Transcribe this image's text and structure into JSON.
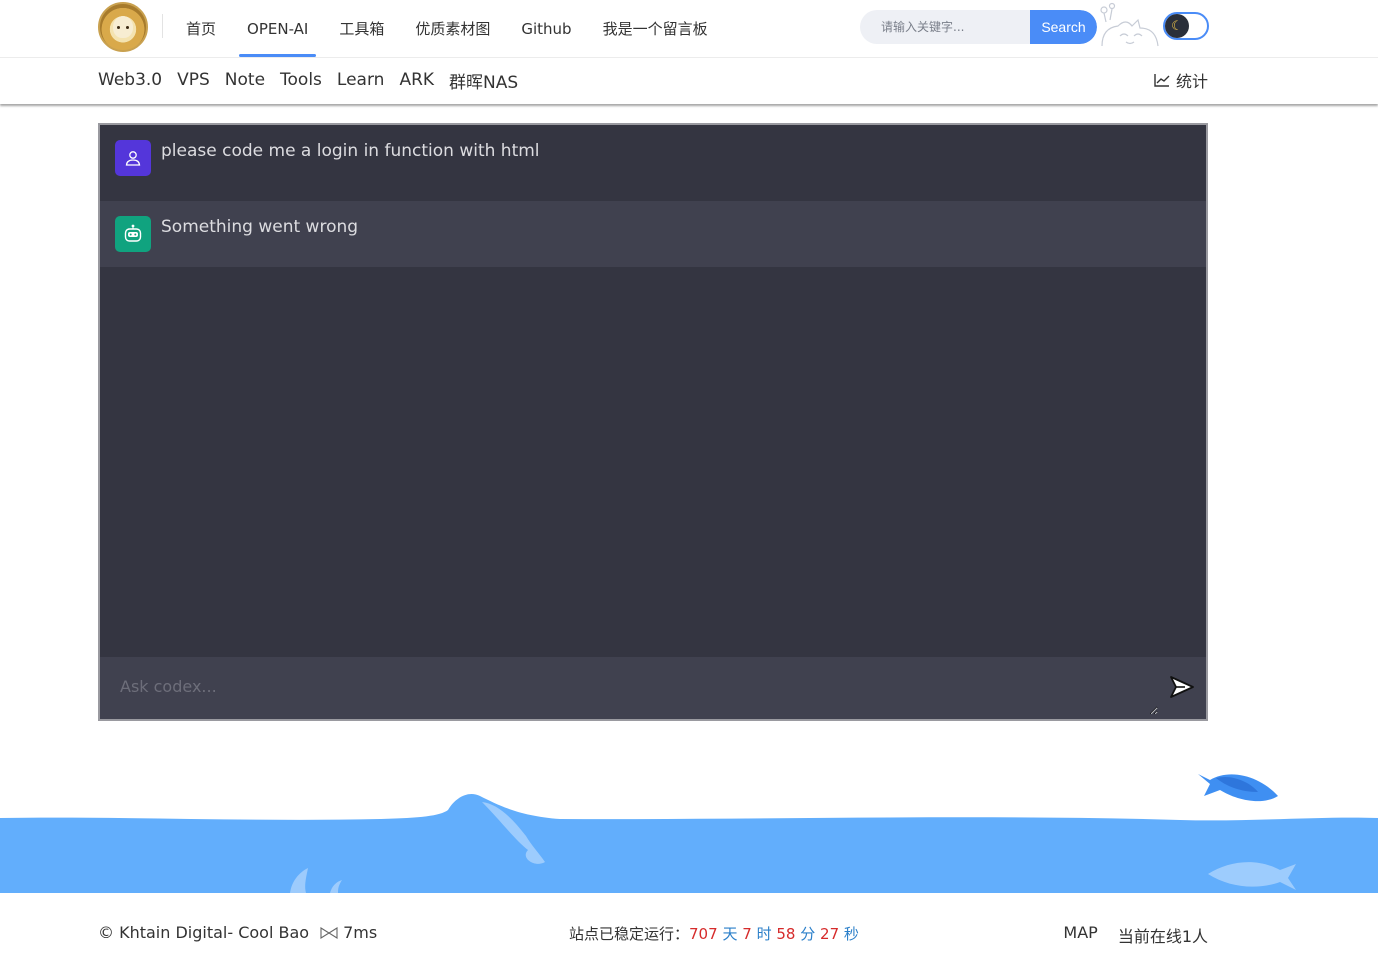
{
  "header": {
    "nav": [
      "首页",
      "OPEN-AI",
      "工具箱",
      "优质素材图",
      "Github",
      "我是一个留言板"
    ],
    "active_index": 1,
    "search": {
      "placeholder": "请输入关键字...",
      "button": "Search"
    },
    "theme_toggle_icon": "moon-icon"
  },
  "subnav": {
    "items": [
      "Web3.0",
      "VPS",
      "Note",
      "Tools",
      "Learn",
      "ARK",
      "群晖NAS"
    ],
    "stats_label": "统计"
  },
  "chat": {
    "messages": [
      {
        "role": "user",
        "text": "please code me a login in function with html"
      },
      {
        "role": "bot",
        "text": "Something went wrong"
      }
    ],
    "input_placeholder": "Ask codex...",
    "colors": {
      "panel": "#343541",
      "bot_row": "#40414f",
      "user_avatar": "#5436da",
      "bot_avatar": "#10a37f"
    }
  },
  "footer": {
    "copyright": "© Khtain Digital- Cool Bao",
    "speed": "7ms",
    "uptime_label": "站点已稳定运行：",
    "uptime": {
      "days": "707",
      "d_unit": "天",
      "hours": "7",
      "h_unit": "时",
      "minutes": "58",
      "m_unit": "分",
      "seconds": "27",
      "s_unit": "秒"
    },
    "map": "MAP",
    "online": "当前在线1人"
  },
  "colors": {
    "accent": "#4a8cf7",
    "water": "#62aefc"
  }
}
